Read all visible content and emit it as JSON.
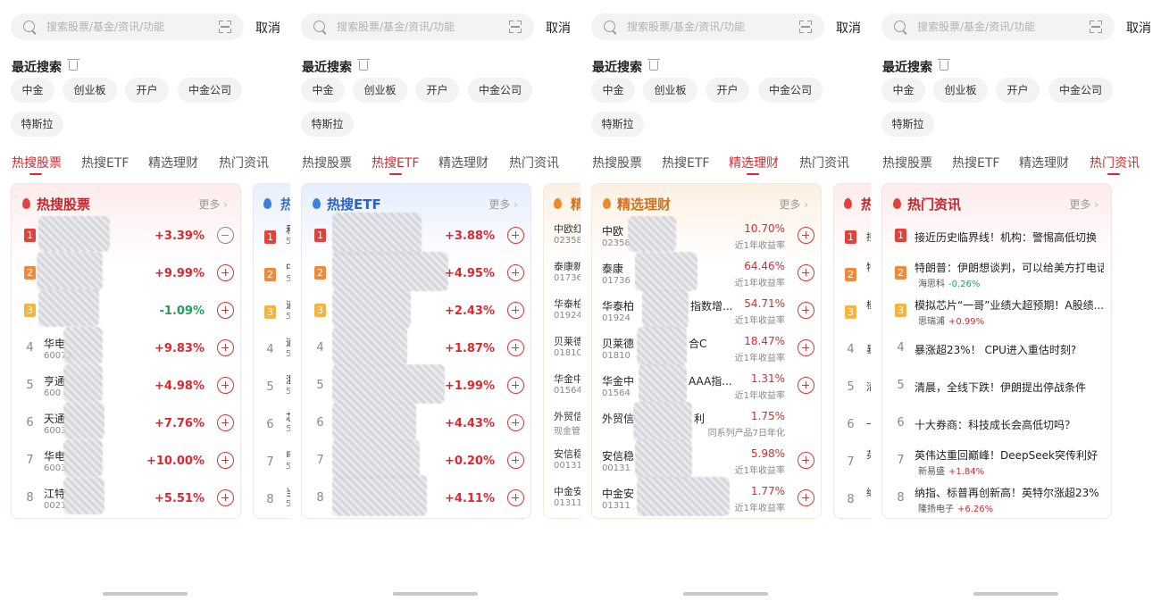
{
  "search": {
    "placeholder": "搜索股票/基金/资讯/功能",
    "cancel": "取消"
  },
  "recent": {
    "title": "最近搜索",
    "items": [
      "中金",
      "创业板",
      "开户",
      "中金公司",
      "特斯拉"
    ]
  },
  "tabs": [
    "热搜股票",
    "热搜ETF",
    "精选理财",
    "热门资讯"
  ],
  "more_label": "更多",
  "colors": {
    "accent": "#d9272e",
    "up": "#e0262e",
    "down": "#21a05a"
  },
  "stocks": {
    "title": "热搜股票",
    "rows": [
      {
        "rank": "1",
        "name": "",
        "code": "",
        "change": "+3.39%",
        "added": true
      },
      {
        "rank": "2",
        "name": "",
        "code": "",
        "change": "+9.99%",
        "added": false
      },
      {
        "rank": "3",
        "name": "",
        "code": "",
        "change": "-1.09%",
        "added": false
      },
      {
        "rank": "4",
        "name": "华电",
        "code": "60072",
        "change": "+9.83%",
        "added": false
      },
      {
        "rank": "5",
        "name": "亨通",
        "code": "600",
        "change": "+4.98%",
        "added": false
      },
      {
        "rank": "6",
        "name": "天通",
        "code": "6003",
        "change": "+7.76%",
        "added": false
      },
      {
        "rank": "7",
        "name": "华电",
        "code": "6003",
        "change": "+10.00%",
        "added": false
      },
      {
        "rank": "8",
        "name": "江特",
        "code": "0021",
        "change": "+5.51%",
        "added": false
      }
    ]
  },
  "etf": {
    "title": "热搜ETF",
    "rows": [
      {
        "rank": "1",
        "change": "+3.88%"
      },
      {
        "rank": "2",
        "change": "+4.95%"
      },
      {
        "rank": "3",
        "change": "+2.43%"
      },
      {
        "rank": "4",
        "change": "+1.87%"
      },
      {
        "rank": "5",
        "change": "+1.99%"
      },
      {
        "rank": "6",
        "change": "+4.43%"
      },
      {
        "rank": "7",
        "change": "+0.20%"
      },
      {
        "rank": "8",
        "change": "+4.11%"
      }
    ]
  },
  "wealth": {
    "title": "精选理财",
    "rows": [
      {
        "name": "中欧",
        "code": "02358",
        "rate": "10.70%",
        "label": "近1年收益率",
        "button": true
      },
      {
        "name": "泰康",
        "code": "01736",
        "rate": "64.46%",
        "label": "近1年收益率",
        "button": true
      },
      {
        "name": "华泰柏",
        "name_tail": "指数增...",
        "code": "01924",
        "rate": "54.71%",
        "label": "近1年收益率",
        "button": true
      },
      {
        "name": "贝莱德",
        "name_tail": "合C",
        "code": "01810",
        "rate": "18.47%",
        "label": "近1年收益率",
        "button": true
      },
      {
        "name": "华金中",
        "name_tail": "AAA指...",
        "code": "01564",
        "rate": "1.31%",
        "label": "近1年收益率",
        "button": true
      },
      {
        "name": "外贸信",
        "name_tail": "利",
        "code": "",
        "rate": "1.75%",
        "label": "同系列产品7日年化",
        "button": false
      },
      {
        "name": "安信稳",
        "code": "00131",
        "rate": "5.98%",
        "label": "近1年收益率",
        "button": true
      },
      {
        "name": "中金安",
        "code": "01311",
        "rate": "1.77%",
        "label": "近1年收益率",
        "button": true
      }
    ],
    "peek": [
      "中欧红",
      "泰康新",
      "华泰柏",
      "贝莱德",
      "华金中",
      "外贸信",
      "安信稳",
      "中金安"
    ],
    "peek_codes": [
      "02358",
      "01736",
      "01924",
      "01810",
      "01564",
      "现金管",
      "00131",
      "01311"
    ]
  },
  "news": {
    "title": "热门资讯",
    "rows": [
      {
        "rank": "1",
        "title": "接近历史临界线！机构：警惕高低切换",
        "stock": "",
        "change": ""
      },
      {
        "rank": "2",
        "title": "特朗普：伊朗想谈判，可以给美方打电话",
        "stock": "海思科",
        "change": "-0.26%"
      },
      {
        "rank": "3",
        "title": "模拟芯片“一哥”业绩大超预期！A股绩...",
        "stock": "思瑞浦",
        "change": "+0.99%"
      },
      {
        "rank": "4",
        "title": "暴涨超23%！ CPU进入重估时刻?",
        "stock": "",
        "change": ""
      },
      {
        "rank": "5",
        "title": "清晨，全线下跌！伊朗提出停战条件",
        "stock": "",
        "change": ""
      },
      {
        "rank": "6",
        "title": "十大券商：科技成长会高低切吗？",
        "stock": "",
        "change": ""
      },
      {
        "rank": "7",
        "title": "英伟达重回巅峰！DeepSeek突传利好",
        "stock": "新易盛",
        "change": "+1.84%"
      },
      {
        "rank": "8",
        "title": "纳指、标普再创新高！英特尔涨超23%",
        "stock": "隆扬电子",
        "change": "+6.26%"
      }
    ]
  },
  "side_peek": {
    "p1_names": [
      "和",
      "中",
      "道",
      "道",
      "浙",
      "芯",
      "电",
      "当"
    ],
    "p1_codes": [
      "5",
      "5",
      "5",
      "5",
      "5",
      "5",
      "5",
      "5"
    ],
    "p4_names": [
      "接",
      "特",
      "模",
      "暴",
      "清",
      "十",
      "英",
      "纳"
    ],
    "p1_title": "热",
    "p2_title": "精",
    "p4_title": "热"
  }
}
